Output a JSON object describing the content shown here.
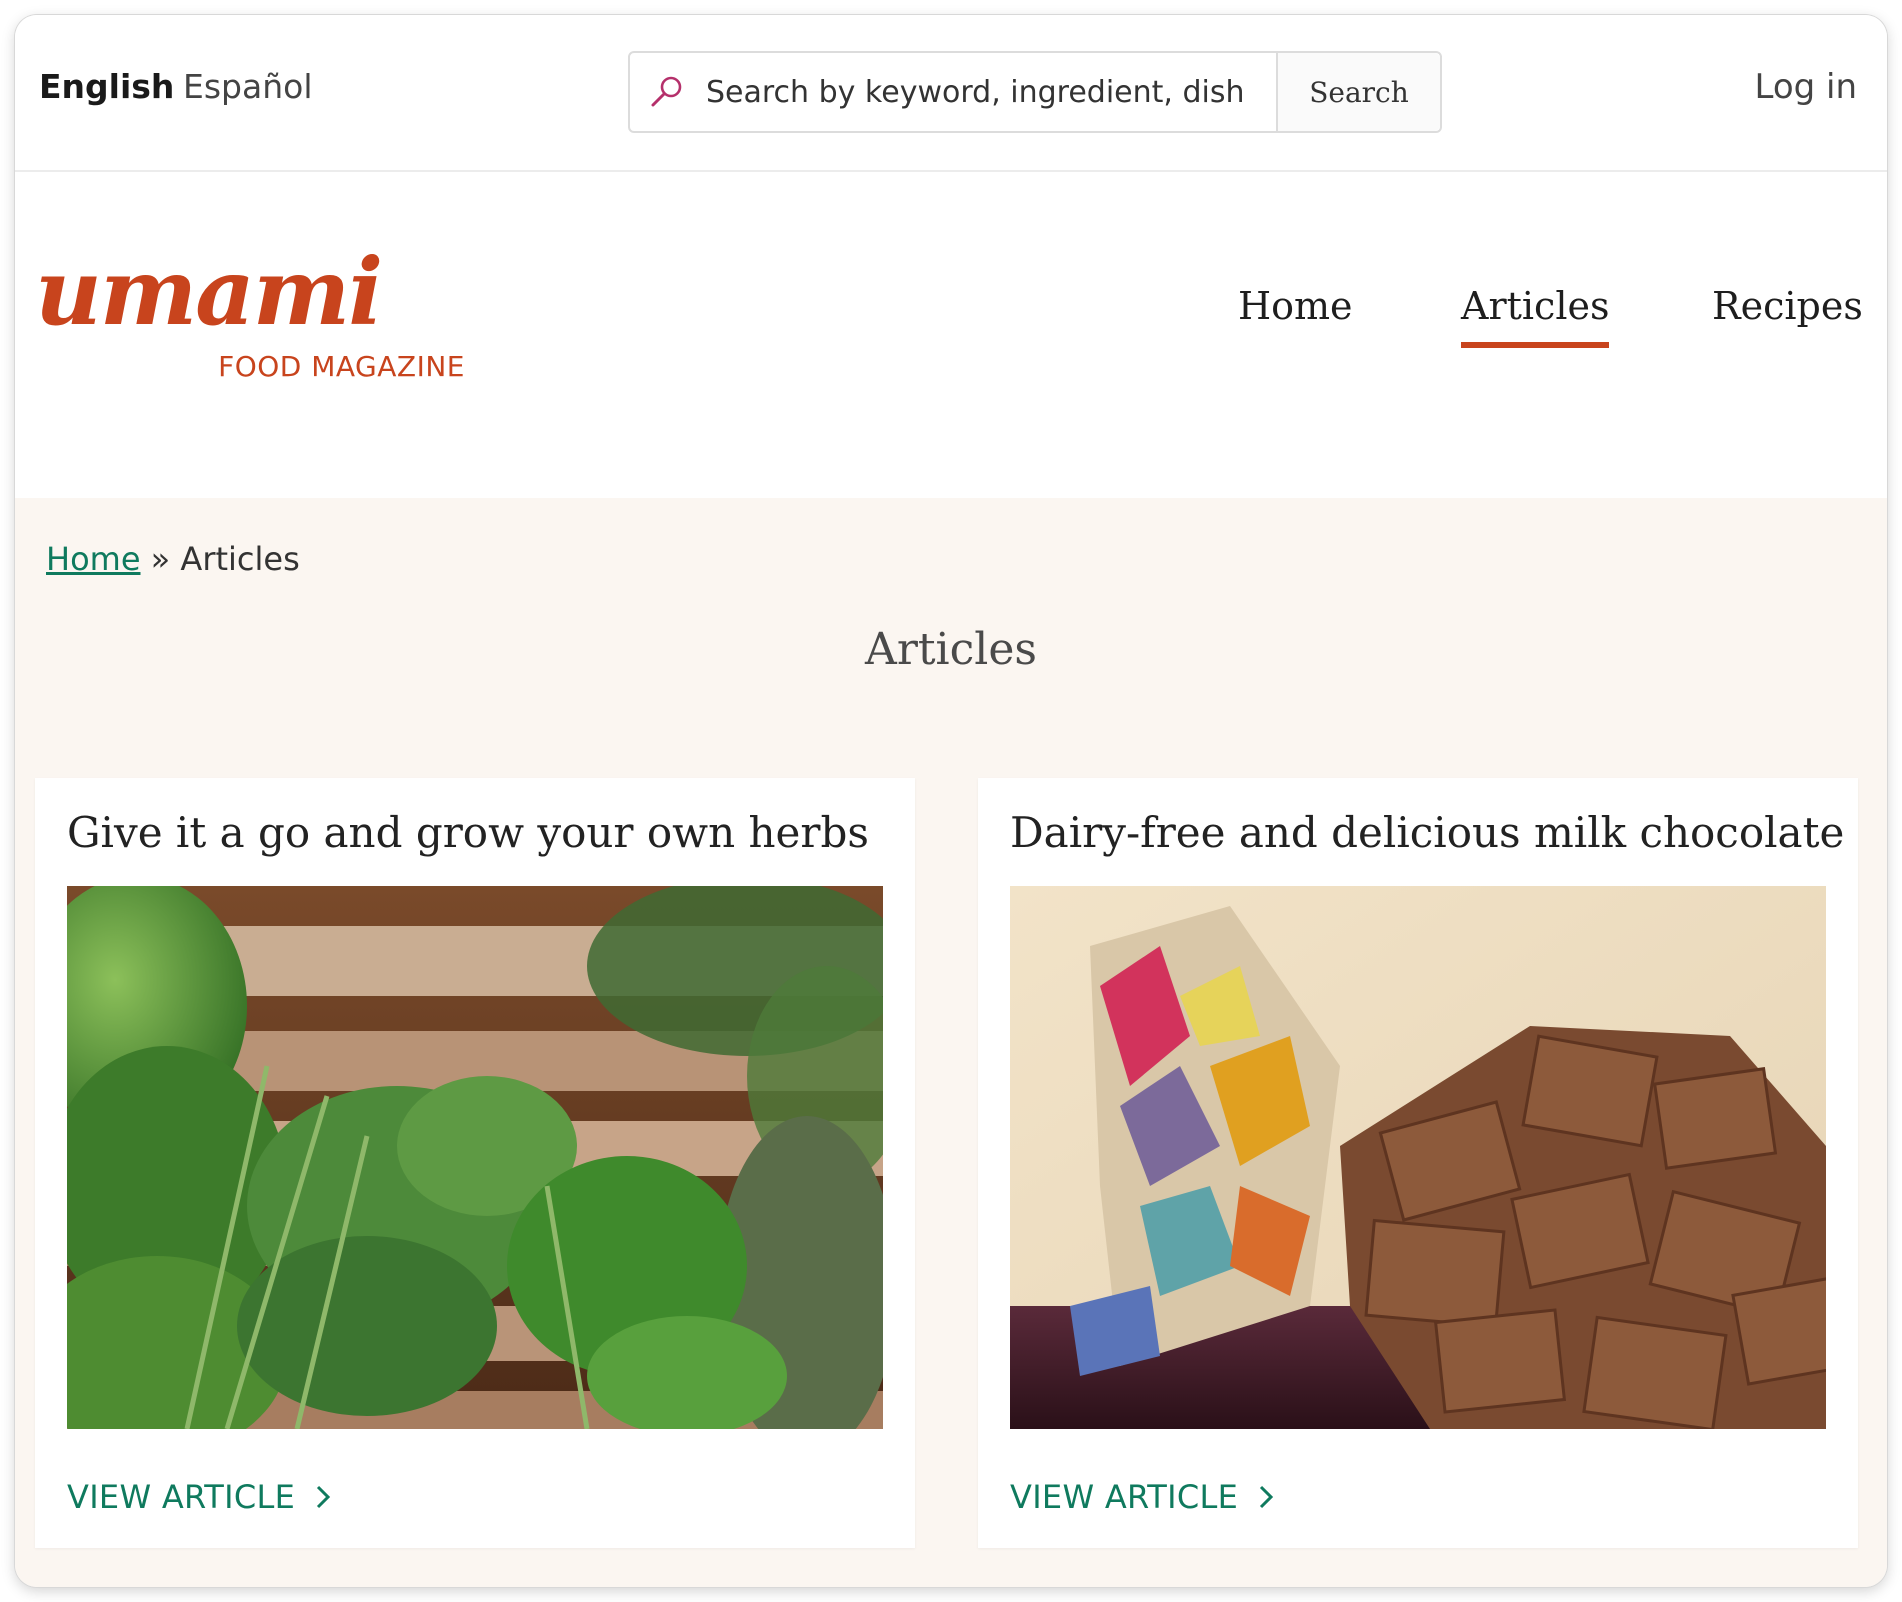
{
  "topbar": {
    "languages": [
      "English",
      "Español"
    ],
    "search": {
      "placeholder": "Search by keyword, ingredient, dish",
      "button_label": "Search"
    },
    "login_label": "Log in"
  },
  "header": {
    "logo": {
      "wordmark": "umami",
      "subtitle": "FOOD MAGAZINE"
    },
    "nav": [
      {
        "label": "Home",
        "active": false
      },
      {
        "label": "Articles",
        "active": true
      },
      {
        "label": "Recipes",
        "active": false
      }
    ]
  },
  "breadcrumb": {
    "home": "Home",
    "separator": "»",
    "current": "Articles"
  },
  "page_title": "Articles",
  "articles": [
    {
      "title": "Give it a go and grow your own herbs",
      "link_label": "VIEW ARTICLE",
      "image": "herbs-on-wooden-crate"
    },
    {
      "title": "Dairy-free and delicious milk chocolate",
      "link_label": "VIEW ARTICLE",
      "image": "chocolate-pieces-in-wrapper"
    }
  ],
  "colors": {
    "brand": "#c8441d",
    "link": "#0f7a5e",
    "content_bg": "#fbf6f1"
  }
}
